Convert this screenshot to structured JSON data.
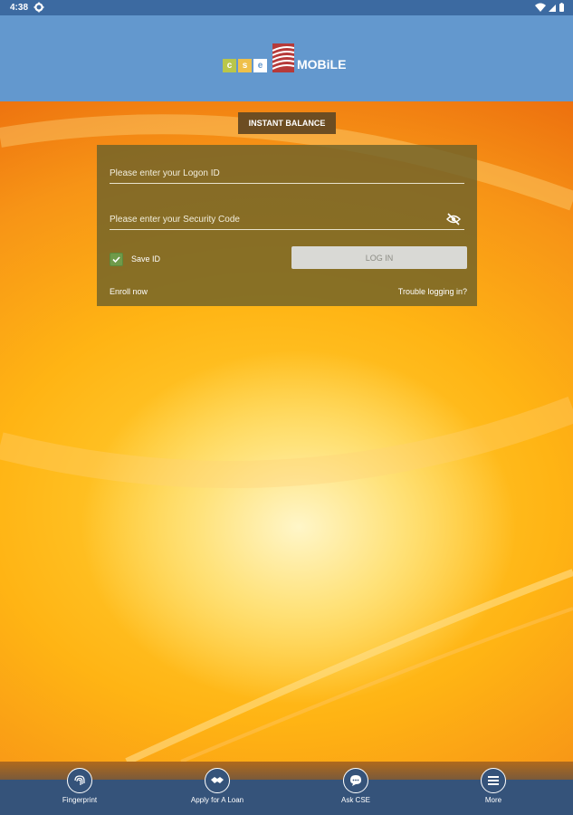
{
  "status_bar": {
    "time": "4:38"
  },
  "header": {
    "logo_letters": [
      "c",
      "s",
      "e"
    ],
    "logo_text": "MOBiLE",
    "brand_colors": {
      "tile1": "#b9c64a",
      "tile2": "#efc04a",
      "tile3": "#6398ce",
      "stripes": "#9e2a2a"
    }
  },
  "instant_balance": {
    "label": "INSTANT BALANCE"
  },
  "login": {
    "logon_id_placeholder": "Please enter your Logon ID",
    "logon_id_value": "",
    "security_code_placeholder": "Please enter your Security Code",
    "security_code_value": "",
    "save_id_label": "Save ID",
    "save_id_checked": true,
    "login_button": "LOG IN",
    "enroll_link": "Enroll now",
    "trouble_link": "Trouble logging in?"
  },
  "bottom_nav": {
    "items": [
      {
        "label": "Fingerprint",
        "icon": "fingerprint-icon"
      },
      {
        "label": "Apply for A Loan",
        "icon": "handshake-icon"
      },
      {
        "label": "Ask CSE",
        "icon": "chat-icon"
      },
      {
        "label": "More",
        "icon": "menu-icon"
      }
    ]
  }
}
